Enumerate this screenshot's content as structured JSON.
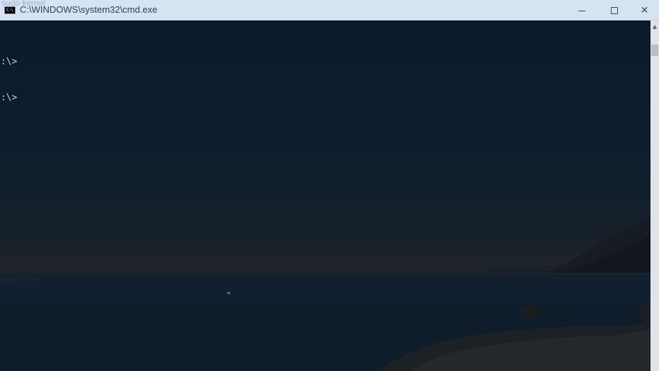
{
  "window": {
    "title": "C:\\WINDOWS\\system32\\cmd.exe",
    "ghost_overlay_text": "sudo kernel"
  },
  "controls": {
    "minimize_icon": "minimize-icon",
    "maximize_icon": "maximize-icon",
    "close_icon": "close-icon",
    "close_glyph": "✕"
  },
  "console": {
    "lines": [
      "D:\\>",
      "D:\\>"
    ]
  },
  "colors": {
    "titlebar_bg": "#d6e3f3",
    "title_text": "#2a3f5a",
    "console_text": "#c8ccd2",
    "scrollbar_bg": "#dfe4ea"
  },
  "scrollbar": {
    "up_glyph": "▲"
  }
}
